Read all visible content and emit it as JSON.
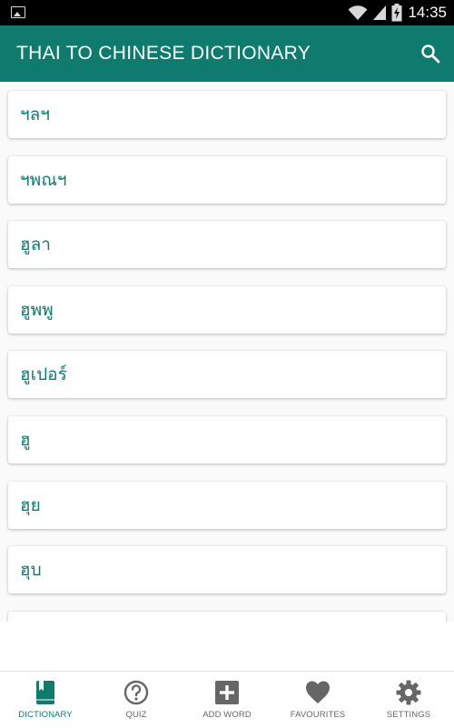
{
  "status_bar": {
    "time": "14:35",
    "left_icon": "picture-icon",
    "wifi_icon": "wifi-icon",
    "signal_icon": "signal-icon",
    "battery_icon": "battery-charging-icon"
  },
  "app_bar": {
    "title": "THAI TO CHINESE DICTIONARY",
    "search_icon": "search-icon"
  },
  "colors": {
    "primary": "#0f7b6f",
    "status_bar": "#000000",
    "inactive_nav": "#666666"
  },
  "words": [
    {
      "label": "ฯลฯ"
    },
    {
      "label": "ฯพณฯ"
    },
    {
      "label": "ฮูลา"
    },
    {
      "label": "ฮูพพู"
    },
    {
      "label": "ฮูเปอร์"
    },
    {
      "label": "ฮู"
    },
    {
      "label": "ฮุย"
    },
    {
      "label": "ฮุบ"
    },
    {
      "label": ""
    }
  ],
  "bottom_nav": {
    "active": "DICTIONARY",
    "items": [
      {
        "label": "DICTIONARY",
        "icon": "book-icon"
      },
      {
        "label": "QUIZ",
        "icon": "question-icon"
      },
      {
        "label": "ADD WORD",
        "icon": "add-icon"
      },
      {
        "label": "FAVOURITES",
        "icon": "heart-icon"
      },
      {
        "label": "SETTINGS",
        "icon": "gear-icon"
      }
    ]
  }
}
